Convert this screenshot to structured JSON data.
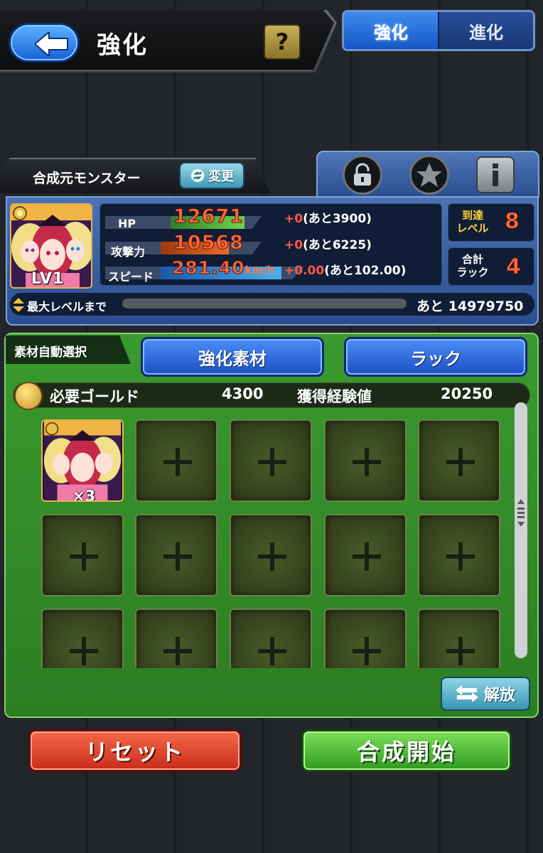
{
  "header": {
    "title": "強化",
    "help_label": "?",
    "tabs": [
      {
        "label": "強化",
        "active": true
      },
      {
        "label": "進化",
        "active": false
      }
    ]
  },
  "monster_panel": {
    "tab_label": "合成元モンスター",
    "change_label": "変更",
    "icons": [
      "lock-icon",
      "star-icon",
      "info-icon"
    ],
    "portrait": {
      "level_label": "LV1"
    },
    "stats": [
      {
        "label": "HP",
        "value": "12671",
        "plus": "+0",
        "remain": "(あと3900)",
        "bar_color": "#49b042"
      },
      {
        "label": "攻撃力",
        "value": "10568",
        "plus": "+0",
        "remain": "(あと6225)",
        "bar_color": "#e05a22"
      },
      {
        "label": "スピード",
        "value": "281.40",
        "unit": "km/h",
        "plus": "+0.00",
        "remain": "(あと102.00)",
        "bar_color": "#2e8fe6"
      }
    ],
    "reach_level": {
      "label_line1": "到達",
      "label_line2": "レベル",
      "value": "8"
    },
    "total_luck": {
      "label_line1": "合計",
      "label_line2": "ラック",
      "value": "4"
    },
    "max_level": {
      "label": "最大レベルまで",
      "remain_label": "あと",
      "remain_value": "14979750",
      "progress": 0
    }
  },
  "material_panel": {
    "auto_select_label": "素材自動選択",
    "buttons": [
      {
        "label": "強化素材"
      },
      {
        "label": "ラック"
      }
    ],
    "gold_label": "必要ゴールド",
    "gold_value": "4300",
    "exp_label": "獲得経験値",
    "exp_value": "20250",
    "slot_filled_multiplier": "×3",
    "release_label": "解放"
  },
  "footer": {
    "reset_label": "リセット",
    "start_label": "合成開始"
  },
  "colors": {
    "accent_blue": "#1a4fc4",
    "panel_green": "#3a9a2e",
    "stat_value_orange": "#ff6a3d",
    "reset_red": "#c92b1a",
    "start_green": "#2f9a1f"
  }
}
